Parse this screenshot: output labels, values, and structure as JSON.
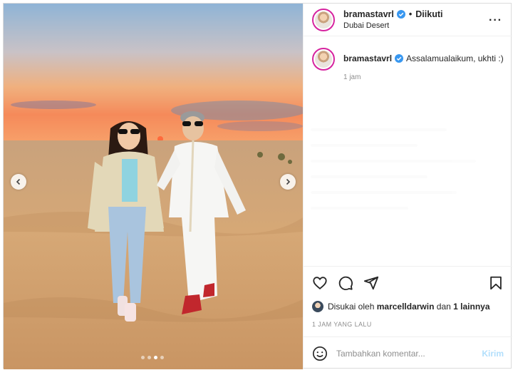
{
  "post": {
    "username": "bramastavrl",
    "follow_status": "Diikuti",
    "location": "Dubai Desert",
    "more_icon": "more-horizontal-icon"
  },
  "caption": {
    "username": "bramastavrl",
    "text": "Assalamualaikum, ukhti :)",
    "time": "1 jam"
  },
  "likes": {
    "prefix": "Disukai oleh",
    "user": "marcelldarwin",
    "connector": "dan",
    "others": "1 lainnya"
  },
  "timestamp": "1 JAM YANG LALU",
  "comment_box": {
    "placeholder": "Tambahkan komentar...",
    "send_label": "Kirim"
  },
  "carousel": {
    "total_slides": 4,
    "active_slide": 3
  },
  "colors": {
    "verified": "#3897f0",
    "story_ring": "#d6249f",
    "send_disabled": "#b2dffc"
  },
  "icons": [
    "heart-icon",
    "comment-icon",
    "share-icon",
    "bookmark-icon",
    "emoji-icon",
    "chevron-left-icon",
    "chevron-right-icon",
    "verified-badge-icon"
  ]
}
